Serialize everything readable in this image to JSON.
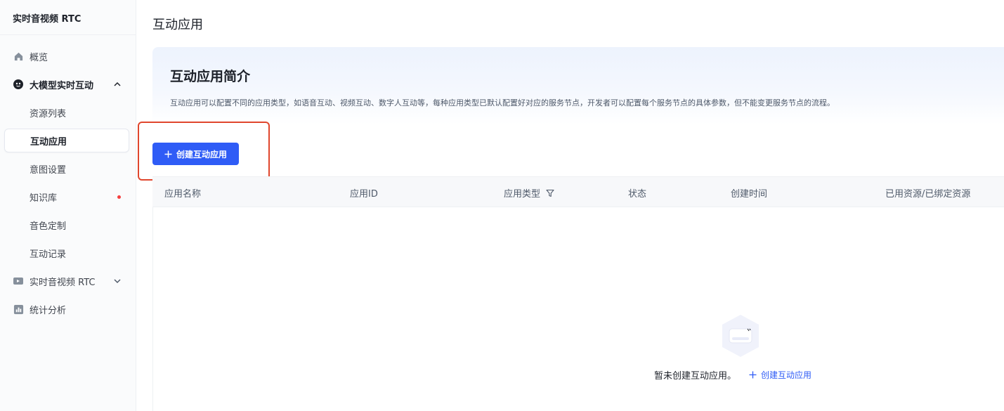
{
  "sidebar": {
    "title": "实时音视频 RTC",
    "items": [
      {
        "label": "概览",
        "icon": "home-icon"
      },
      {
        "label": "大模型实时互动",
        "icon": "ai-bot-icon"
      },
      {
        "label": "资源列表"
      },
      {
        "label": "互动应用"
      },
      {
        "label": "意图设置"
      },
      {
        "label": "知识库"
      },
      {
        "label": "音色定制"
      },
      {
        "label": "互动记录"
      },
      {
        "label": "实时音视频 RTC",
        "icon": "video-icon"
      },
      {
        "label": "统计分析",
        "icon": "chart-icon"
      }
    ]
  },
  "page": {
    "title": "互动应用"
  },
  "intro": {
    "title": "互动应用简介",
    "description": "互动应用可以配置不同的应用类型，如语音互动、视频互动、数字人互动等，每种应用类型已默认配置好对应的服务节点，开发者可以配置每个服务节点的具体参数，但不能变更服务节点的流程。"
  },
  "actions": {
    "create_label": "创建互动应用"
  },
  "table": {
    "columns": [
      "应用名称",
      "应用ID",
      "应用类型",
      "状态",
      "创建时间",
      "已用资源/已绑定资源"
    ]
  },
  "empty": {
    "text": "暂未创建互动应用。",
    "link_label": "创建互动应用"
  },
  "colors": {
    "primary": "#2f5cf6",
    "highlight_border": "#e0462d",
    "badge_dot": "#f53f3f"
  }
}
